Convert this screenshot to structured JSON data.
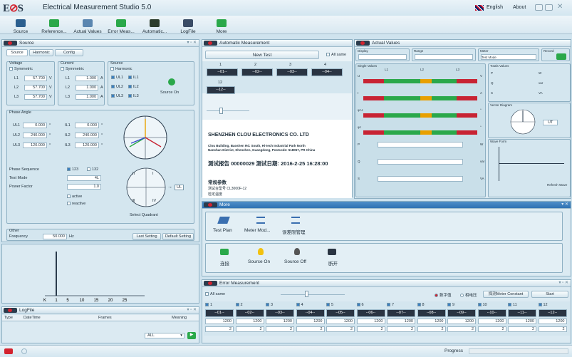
{
  "app": {
    "title": "Electrical Measurement Studio 5.0",
    "language": "English",
    "about": "About"
  },
  "toolbar": {
    "items": [
      {
        "label": "Source",
        "color": "#2b5f8f"
      },
      {
        "label": "Reference...",
        "color": "#2aa84a"
      },
      {
        "label": "Actual Values",
        "color": "#5a86b0"
      },
      {
        "label": "Error Meas...",
        "color": "#2aa84a"
      },
      {
        "label": "Automatic...",
        "color": "#2b3c2b"
      },
      {
        "label": "LogFile",
        "color": "#3a4c66"
      },
      {
        "label": "More",
        "color": "#2aa84a"
      }
    ]
  },
  "source": {
    "title": "Source",
    "tabs": [
      "Source",
      "Harmonic",
      "Config"
    ],
    "voltage": {
      "label": "Voltage",
      "mode": "Symmetric",
      "rows": [
        {
          "name": "L1",
          "value": "57.700",
          "unit": "V"
        },
        {
          "name": "L2",
          "value": "57.700",
          "unit": "V"
        },
        {
          "name": "L3",
          "value": "57.700",
          "unit": "V"
        }
      ]
    },
    "current": {
      "label": "Current",
      "mode": "Symmetric",
      "rows": [
        {
          "name": "L1",
          "value": "1.000",
          "unit": "A"
        },
        {
          "name": "L2",
          "value": "1.000",
          "unit": "A"
        },
        {
          "name": "L3",
          "value": "1.000",
          "unit": "A"
        }
      ]
    },
    "src": {
      "label": "Source",
      "harmonic": "Harmonic",
      "checks": [
        "UL1",
        "IL1",
        "UL2",
        "IL2",
        "UL3",
        "IL3"
      ],
      "source_on": "Source On"
    },
    "phase": {
      "label": "Phase Angle",
      "u": [
        {
          "name": "UL1",
          "value": "0.000",
          "unit": "°"
        },
        {
          "name": "UL2",
          "value": "240.000",
          "unit": "°"
        },
        {
          "name": "UL3",
          "value": "120.000",
          "unit": "°"
        }
      ],
      "i": [
        {
          "name": "IL1",
          "value": "0.000",
          "unit": "°"
        },
        {
          "name": "IL2",
          "value": "240.000",
          "unit": "°"
        },
        {
          "name": "IL3",
          "value": "120.000",
          "unit": "°"
        }
      ]
    },
    "seq_label": "Phase Sequence",
    "seq_opts": [
      "123",
      "132"
    ],
    "mode_label": "Test Mode",
    "mode_value": "4L",
    "pf_label": "Power Factor",
    "pf_value": "1.0",
    "active": "active",
    "reactive": "reactive",
    "quadrant_label": "Select Quadrant",
    "quads": [
      "II",
      "I",
      "III",
      "IV"
    ],
    "ul": "UL",
    "other": "Other",
    "freq_label": "Frequency",
    "freq_value": "50.000",
    "freq_unit": "Hz",
    "last_setting": "Last Setting",
    "default_setting": "Default Setting",
    "harmonic_ticks": [
      "K",
      "1",
      "5",
      "10",
      "15",
      "20",
      "25"
    ],
    "harmonic_bars": [
      {
        "x": "1",
        "v": 1.0
      }
    ]
  },
  "logfile": {
    "title": "LogFile",
    "cols": [
      "Type",
      "DateTime",
      "Frames",
      "Meaning"
    ],
    "filter": "ALL"
  },
  "auto": {
    "title": "Automatic Measurement",
    "new_test": "New Test",
    "all_same": "All same",
    "cols": [
      "1",
      "2",
      "3",
      "4"
    ],
    "slots": [
      "--01--",
      "--02--",
      "--03--",
      "--04--"
    ],
    "slot12_n": "12",
    "slot12": "--12--",
    "company": "SHENZHEN CLOU ELECTRONICS CO. LTD",
    "addr1": "Clou Building, Baoshen Rd. South, Hi-tech Industrial Park North",
    "addr2": "Nanshan District, Shenzhen, Guangdong, Postcode: 518057, PR China",
    "report": "测试报告 00000029 测试日期: 2016-2-25 16:28:00",
    "params": "常规参数",
    "model": "测试台型号 CL3000F-12",
    "cutoff": "检定温度"
  },
  "actual": {
    "title": "Actual Values",
    "display": "Display",
    "range": "Range",
    "meter": "Meter",
    "meter_mode": "Test Mode",
    "record": "Record",
    "single": "Single Values",
    "cols": [
      "L1",
      "L2",
      "L3"
    ],
    "rows": [
      "U",
      "I",
      "φ U",
      "φ I",
      "P",
      "Q",
      "S"
    ],
    "units": [
      "V",
      "A",
      "°",
      "°",
      "W",
      "var",
      "VA"
    ],
    "totals": "Totals Values",
    "vector": "Vector Diagram",
    "wave": "Wave Form",
    "refresh": "Refresh Wave",
    "ut": "UT",
    "tot_units": [
      "W",
      "var",
      "VA"
    ],
    "tot_labels": [
      "P",
      "Q",
      "S"
    ]
  },
  "more": {
    "title": "More",
    "items": [
      "Test Plan",
      "Meter Mod...",
      "误差限管理"
    ],
    "items2": [
      "连接",
      "Source On",
      "Source Off",
      "断开"
    ]
  },
  "error": {
    "title": "Error Measurement",
    "all_same": "All same",
    "radio1": "数字值",
    "radio2": "相电压",
    "btn": "探测Meter Constant",
    "start": "Start",
    "cols": [
      {
        "n": "1",
        "s": "--01--",
        "c": "1200",
        "p": "2"
      },
      {
        "n": "2",
        "s": "--02--",
        "c": "1200",
        "p": "2"
      },
      {
        "n": "3",
        "s": "--03--",
        "c": "1200",
        "p": "2"
      },
      {
        "n": "4",
        "s": "--04--",
        "c": "1200",
        "p": "2"
      },
      {
        "n": "5",
        "s": "--05--",
        "c": "1200",
        "p": "2"
      },
      {
        "n": "6",
        "s": "--06--",
        "c": "1200",
        "p": "2"
      },
      {
        "n": "7",
        "s": "--07--",
        "c": "1200",
        "p": "2"
      },
      {
        "n": "8",
        "s": "--08--",
        "c": "1200",
        "p": "2"
      },
      {
        "n": "9",
        "s": "--09--",
        "c": "1200",
        "p": "2"
      },
      {
        "n": "10",
        "s": "--10--",
        "c": "1200",
        "p": "2"
      },
      {
        "n": "11",
        "s": "--11--",
        "c": "1200",
        "p": "2"
      },
      {
        "n": "12",
        "s": "--12--",
        "c": "1200",
        "p": "2"
      }
    ]
  },
  "status": {
    "progress": "Progress",
    "progress_value": 0
  }
}
